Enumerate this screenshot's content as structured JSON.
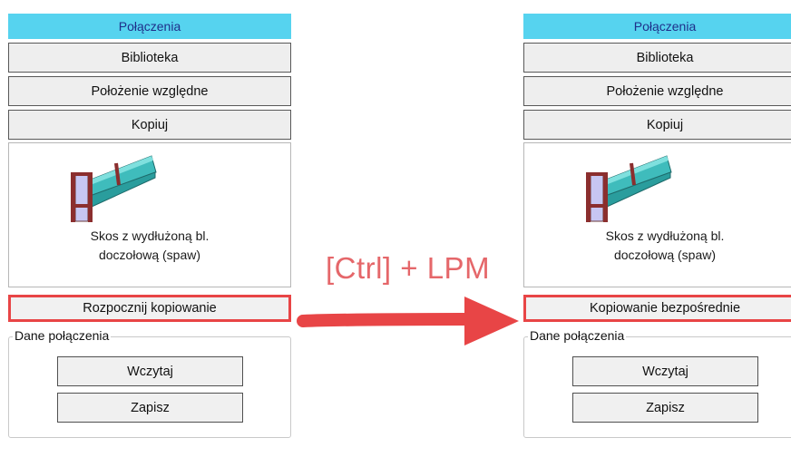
{
  "left_panel": {
    "header": "Połączenia",
    "buttons": [
      "Biblioteka",
      "Położenie względne",
      "Kopiuj"
    ],
    "preview_line1": "Skos z wydłużoną bl.",
    "preview_line2": "doczołową (spaw)",
    "copy_button": "Rozpocznij kopiowanie",
    "group_title": "Dane połączenia",
    "load_button": "Wczytaj",
    "save_button": "Zapisz"
  },
  "right_panel": {
    "header": "Połączenia",
    "buttons": [
      "Biblioteka",
      "Położenie względne",
      "Kopiuj"
    ],
    "preview_line1": "Skos z wydłużoną bl.",
    "preview_line2": "doczołową (spaw)",
    "copy_button": "Kopiowanie bezpośrednie",
    "group_title": "Dane połączenia",
    "load_button": "Wczytaj",
    "save_button": "Zapisz"
  },
  "annotation": {
    "shortcut": "[Ctrl] + LPM",
    "arrow_icon": "right-arrow-icon",
    "highlight_color": "#e84546"
  },
  "colors": {
    "header_bg": "#56d3ef",
    "header_text": "#1f2f8a"
  }
}
